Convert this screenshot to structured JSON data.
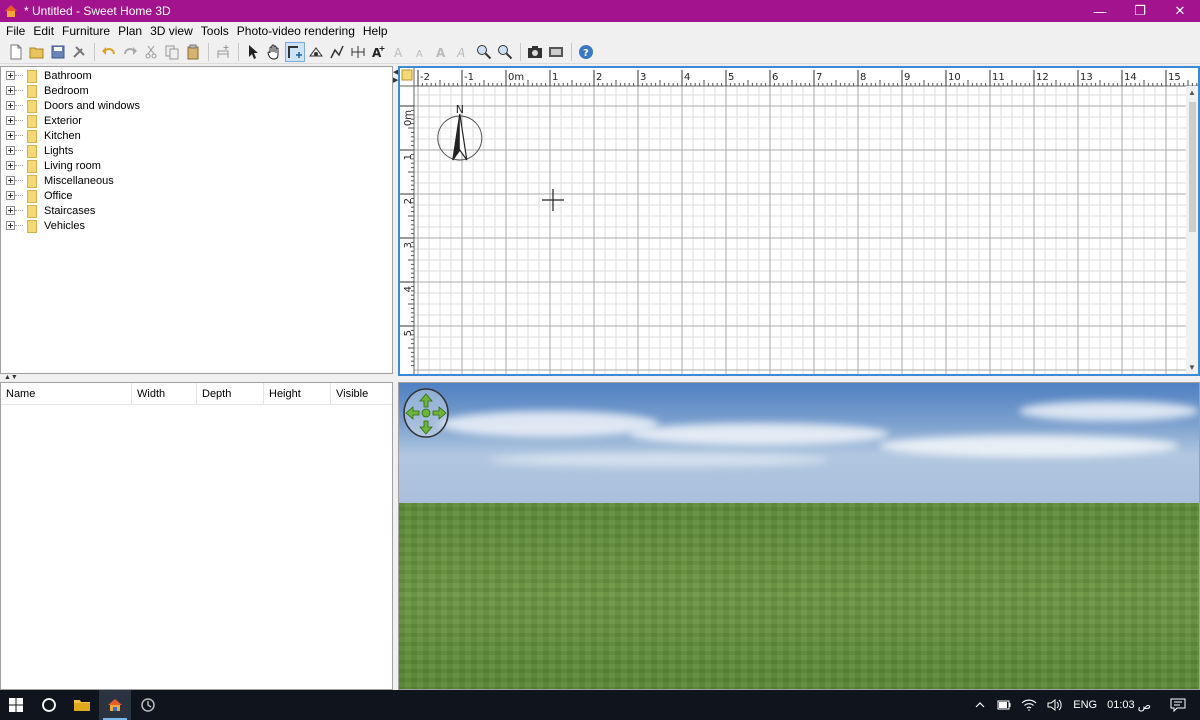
{
  "window": {
    "title": "* Untitled - Sweet Home 3D",
    "minimize": "—",
    "maximize": "❐",
    "close": "✕"
  },
  "menu": [
    "File",
    "Edit",
    "Furniture",
    "Plan",
    "3D view",
    "Tools",
    "Photo-video rendering",
    "Help"
  ],
  "catalog": {
    "categories": [
      "Bathroom",
      "Bedroom",
      "Doors and windows",
      "Exterior",
      "Kitchen",
      "Lights",
      "Living room",
      "Miscellaneous",
      "Office",
      "Staircases",
      "Vehicles"
    ]
  },
  "furniture_table": {
    "columns": [
      "Name",
      "Width",
      "Depth",
      "Height",
      "Visible"
    ]
  },
  "plan": {
    "x_ruler": [
      "-2",
      "-1",
      "0m",
      "1",
      "2",
      "3",
      "4",
      "5",
      "6",
      "7",
      "8",
      "9",
      "10",
      "11",
      "12",
      "13",
      "14",
      "15"
    ],
    "y_ruler": [
      "0m",
      "1",
      "2",
      "3",
      "4",
      "5"
    ],
    "compass_label": "N"
  },
  "taskbar": {
    "language": "ENG",
    "time": "01:03",
    "ampm": "ص"
  },
  "colors": {
    "titlebar": "#a4138e",
    "plan_border": "#3a8ad6",
    "taskbar": "#10141c"
  }
}
